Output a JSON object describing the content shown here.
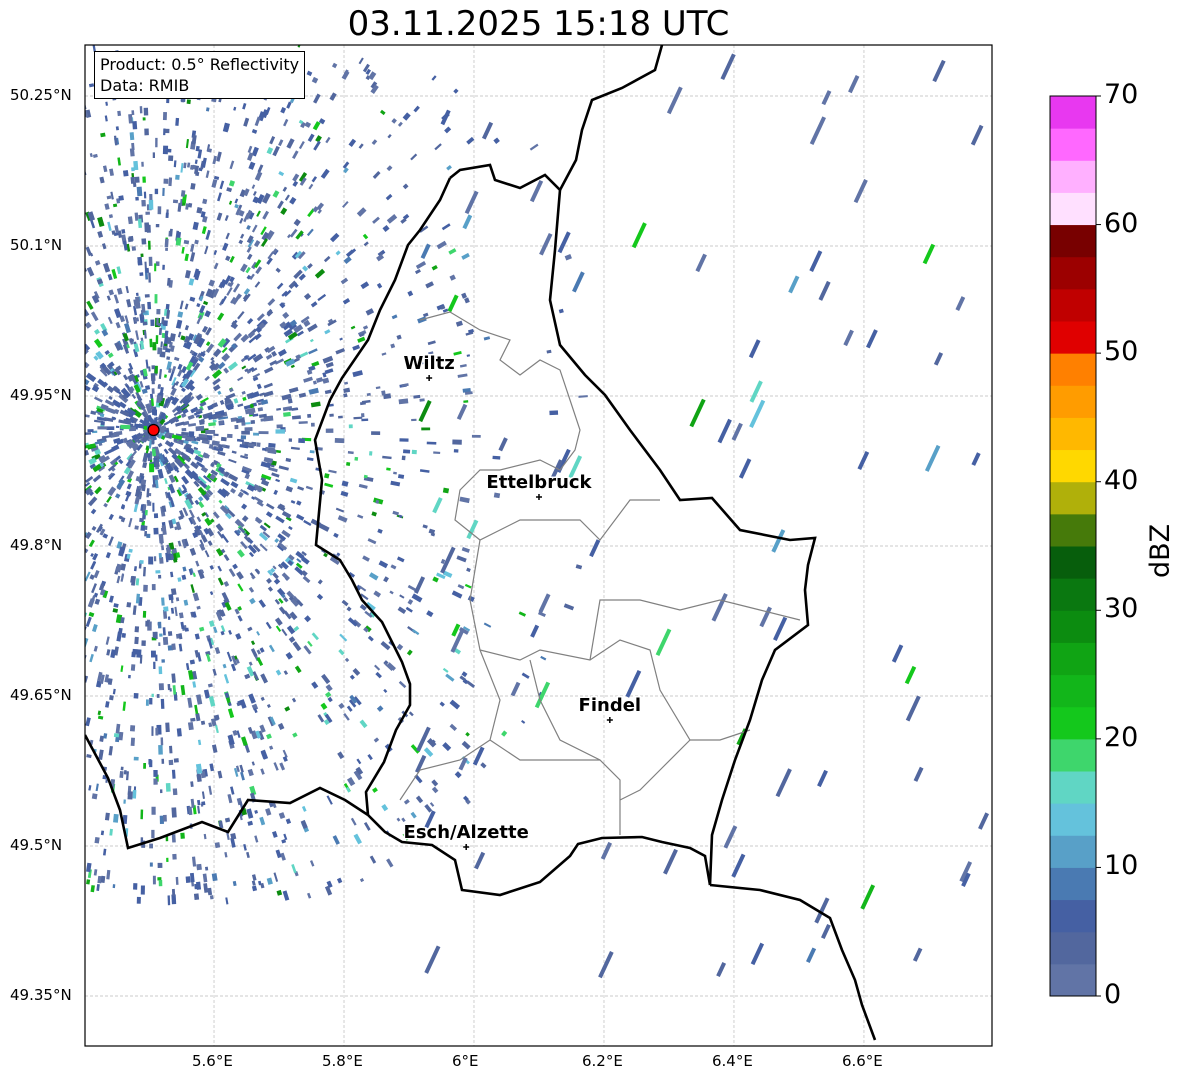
{
  "title": "03.11.2025 15:18 UTC",
  "info": {
    "line1": "Product: 0.5° Reflectivity",
    "line2": "Data: RMIB"
  },
  "map": {
    "lon_range": [
      5.4015,
      6.797
    ],
    "lat_range": [
      49.3,
      50.301
    ],
    "lon_ticks": [
      {
        "v": 5.6,
        "label": "5.6°E"
      },
      {
        "v": 5.8,
        "label": "5.8°E"
      },
      {
        "v": 6.0,
        "label": "6°E"
      },
      {
        "v": 6.2,
        "label": "6.2°E"
      },
      {
        "v": 6.4,
        "label": "6.4°E"
      },
      {
        "v": 6.6,
        "label": "6.6°E"
      }
    ],
    "lat_ticks": [
      {
        "v": 50.25,
        "label": "50.25°N"
      },
      {
        "v": 50.1,
        "label": "50.1°N"
      },
      {
        "v": 49.95,
        "label": "49.95°N"
      },
      {
        "v": 49.8,
        "label": "49.8°N"
      },
      {
        "v": 49.65,
        "label": "49.65°N"
      },
      {
        "v": 49.5,
        "label": "49.5°N"
      },
      {
        "v": 49.35,
        "label": "49.35°N"
      }
    ],
    "radar_site": {
      "lon": 5.507,
      "lat": 49.916,
      "color": "#ff0000"
    },
    "cities": [
      {
        "name": "Wiltz",
        "lon": 5.931,
        "lat": 49.968
      },
      {
        "name": "Ettelbruck",
        "lon": 6.1,
        "lat": 49.849
      },
      {
        "name": "Findel",
        "lon": 6.209,
        "lat": 49.626
      },
      {
        "name": "Esch/Alzette",
        "lon": 5.988,
        "lat": 49.499
      }
    ]
  },
  "colorbar": {
    "label": "dBZ",
    "min": 0,
    "max": 70,
    "ticks": [
      "0",
      "10",
      "20",
      "30",
      "40",
      "50",
      "60",
      "70"
    ],
    "colors": [
      "#6174a6",
      "#52679e",
      "#4560a3",
      "#4a7ab2",
      "#58a0c8",
      "#64c2dc",
      "#60d6c4",
      "#3ed66c",
      "#14c81c",
      "#12b61a",
      "#10a414",
      "#0c8c10",
      "#0a7810",
      "#075e0c",
      "#467a0a",
      "#b0b00a",
      "#ffd800",
      "#ffb800",
      "#ff9c00",
      "#ff8000",
      "#e00000",
      "#c00000",
      "#9c0000",
      "#780000",
      "#ffe0ff",
      "#ffb0ff",
      "#ff68ff",
      "#e838f0"
    ]
  }
}
